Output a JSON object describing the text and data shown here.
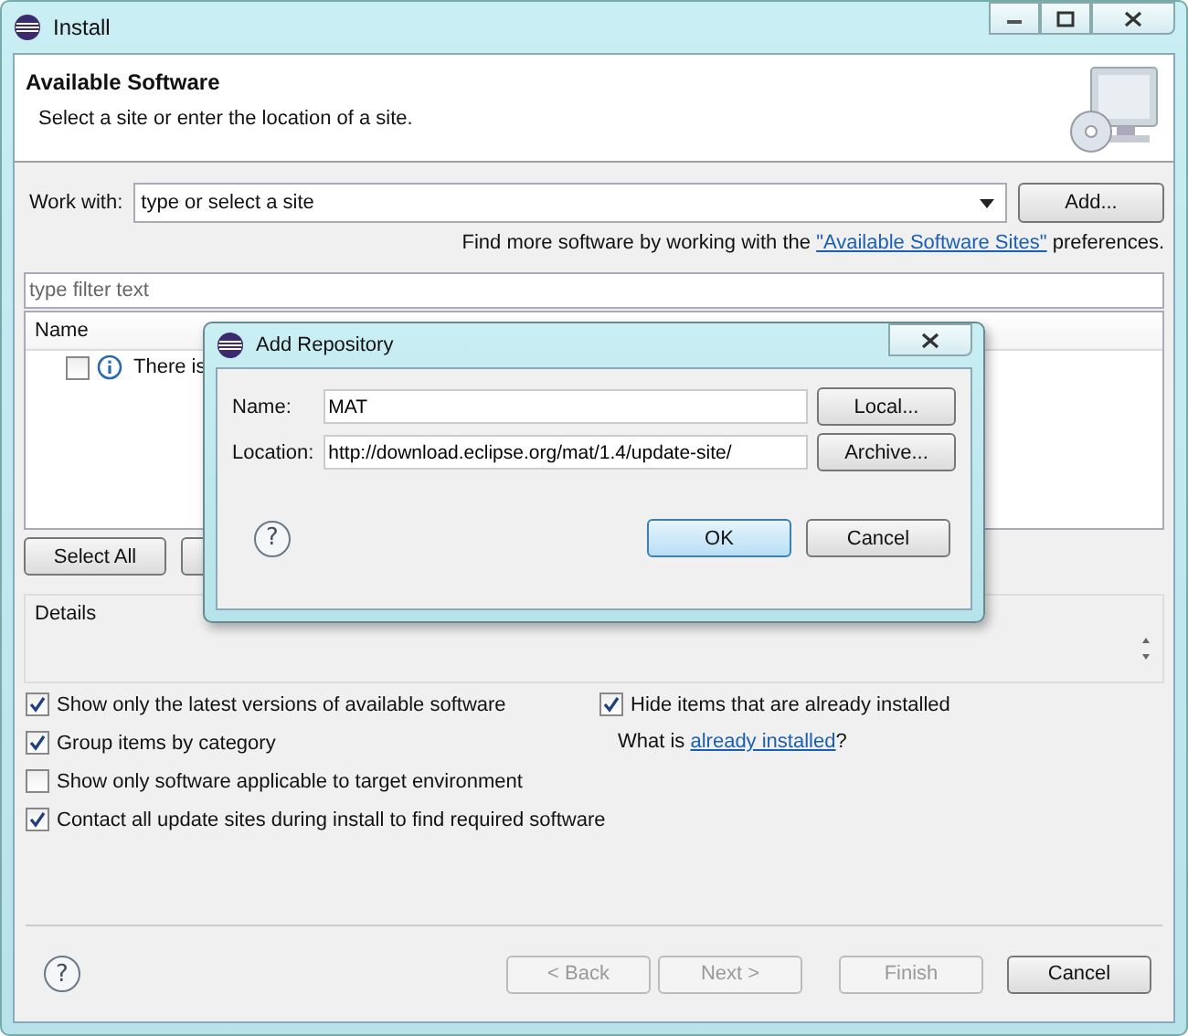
{
  "window": {
    "title": "Install"
  },
  "header": {
    "title": "Available Software",
    "subtitle": "Select a site or enter the location of a site."
  },
  "work_with": {
    "label": "Work with:",
    "value": "type or select a site",
    "button": "Add..."
  },
  "sites_note": {
    "before": "Find more software by working with the ",
    "link": "\"Available Software Sites\"",
    "after": " preferences."
  },
  "filter": {
    "placeholder": "type filter text"
  },
  "table": {
    "columns": [
      "Name"
    ],
    "rows": [
      {
        "checked": false,
        "text": "There is"
      }
    ]
  },
  "help": "?",
  "list_buttons": [
    "Select All"
  ],
  "details": {
    "label": "Details"
  },
  "options_left": [
    {
      "label": "Show only the latest versions of available software",
      "checked": true
    },
    {
      "label": "Group items by category",
      "checked": true
    },
    {
      "label": "Show only software applicable to target environment",
      "checked": false
    },
    {
      "label": "Contact all update sites during install to find required software",
      "checked": true
    }
  ],
  "options_right": [
    {
      "label": "Hide items that are already installed",
      "checked": true
    }
  ],
  "installed_note": {
    "before": "What is ",
    "link": "already installed",
    "after": "?"
  },
  "footer_buttons": [
    {
      "label": "< Back",
      "disabled": true
    },
    {
      "label": "Next >",
      "disabled": true
    },
    {
      "label": "Finish",
      "disabled": true
    },
    {
      "label": "Cancel",
      "disabled": false
    }
  ],
  "dialog": {
    "title": "Add Repository",
    "fields": [
      {
        "label": "Name:",
        "value": "MAT",
        "button": "Local..."
      },
      {
        "label": "Location:",
        "value": "http://download.eclipse.org/mat/1.4/update-site/",
        "button": "Archive..."
      }
    ],
    "buttons": [
      {
        "label": "OK",
        "default": true
      },
      {
        "label": "Cancel",
        "default": false
      }
    ]
  }
}
